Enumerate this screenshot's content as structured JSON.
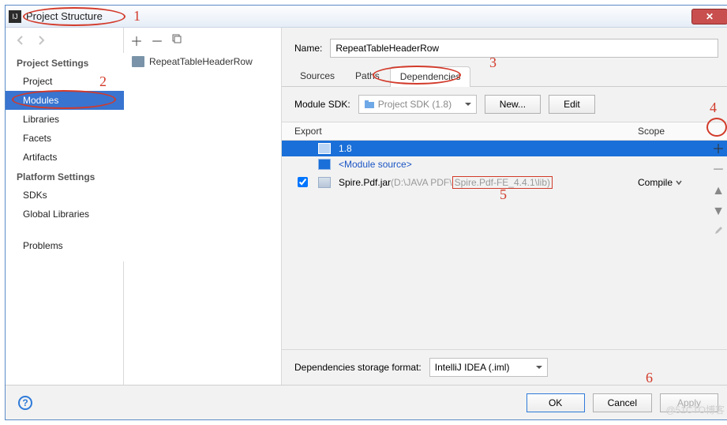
{
  "window": {
    "title": "Project Structure"
  },
  "sidebar": {
    "heading1": "Project Settings",
    "items1": [
      "Project",
      "Modules",
      "Libraries",
      "Facets",
      "Artifacts"
    ],
    "heading2": "Platform Settings",
    "items2": [
      "SDKs",
      "Global Libraries"
    ],
    "problems": "Problems"
  },
  "modules": {
    "selected": "RepeatTableHeaderRow"
  },
  "main": {
    "name_label": "Name:",
    "name_value": "RepeatTableHeaderRow",
    "tabs": [
      "Sources",
      "Paths",
      "Dependencies"
    ],
    "sdk_label": "Module SDK:",
    "sdk_value": "Project SDK (1.8)",
    "new_btn": "New...",
    "edit_btn": "Edit",
    "col_export": "Export",
    "col_scope": "Scope",
    "dep_rows": [
      {
        "label": "1.8"
      },
      {
        "label": "<Module source>"
      },
      {
        "label": "Spire.Pdf.jar ",
        "path_pre": "(D:\\JAVA PDF\\",
        "path_hl": "Spire.Pdf-FE_4.4.1\\lib)",
        "scope": "Compile"
      }
    ],
    "storage_label": "Dependencies storage format:",
    "storage_value": "IntelliJ IDEA (.iml)"
  },
  "footer": {
    "ok": "OK",
    "cancel": "Cancel",
    "apply": "Apply"
  },
  "annotations": {
    "a1": "1",
    "a2": "2",
    "a3": "3",
    "a4": "4",
    "a5": "5",
    "a6": "6"
  },
  "watermark": "@51CTO博客"
}
